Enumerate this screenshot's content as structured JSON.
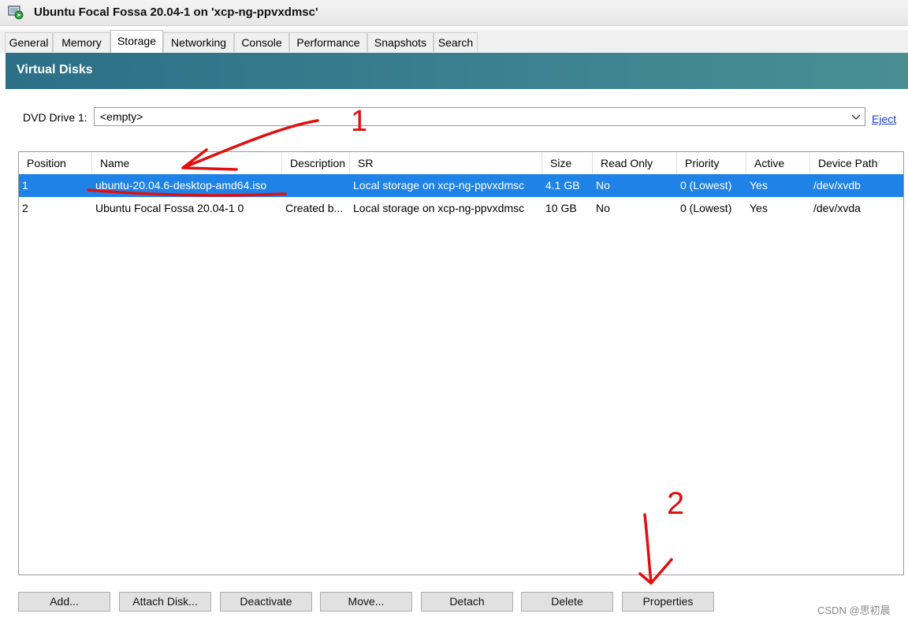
{
  "window": {
    "title": "Ubuntu Focal Fossa 20.04-1 on 'xcp-ng-ppvxdmsc'"
  },
  "tabs": [
    {
      "label": "General"
    },
    {
      "label": "Memory"
    },
    {
      "label": "Storage"
    },
    {
      "label": "Networking"
    },
    {
      "label": "Console"
    },
    {
      "label": "Performance"
    },
    {
      "label": "Snapshots"
    },
    {
      "label": "Search"
    }
  ],
  "active_tab": "Storage",
  "section": {
    "title": "Virtual Disks"
  },
  "dvd": {
    "label": "DVD Drive 1:",
    "value": "<empty>",
    "eject": "Eject"
  },
  "table": {
    "columns": [
      "Position",
      "Name",
      "Description",
      "SR",
      "Size",
      "Read Only",
      "Priority",
      "Active",
      "Device Path"
    ],
    "rows": [
      [
        "1",
        "ubuntu-20.04.6-desktop-amd64.iso",
        "",
        "Local storage on xcp-ng-ppvxdmsc",
        "4.1 GB",
        "No",
        "0 (Lowest)",
        "Yes",
        "/dev/xvdb"
      ],
      [
        "2",
        "Ubuntu Focal Fossa 20.04-1 0",
        "Created b...",
        "Local storage on xcp-ng-ppvxdmsc",
        "10 GB",
        "No",
        "0 (Lowest)",
        "Yes",
        "/dev/xvda"
      ]
    ],
    "selected_row": 0
  },
  "buttons": {
    "add": "Add...",
    "attach": "Attach Disk...",
    "deactivate": "Deactivate",
    "move": "Move...",
    "detach": "Detach",
    "delete": "Delete",
    "properties": "Properties"
  },
  "annotations": {
    "mark1": "1",
    "mark2": "2"
  },
  "watermark": "CSDN @思初晨",
  "colors": {
    "header": "#2c6f87",
    "selection": "#1e82e6",
    "annotation": "#e01010",
    "link": "#1a3fd6"
  }
}
